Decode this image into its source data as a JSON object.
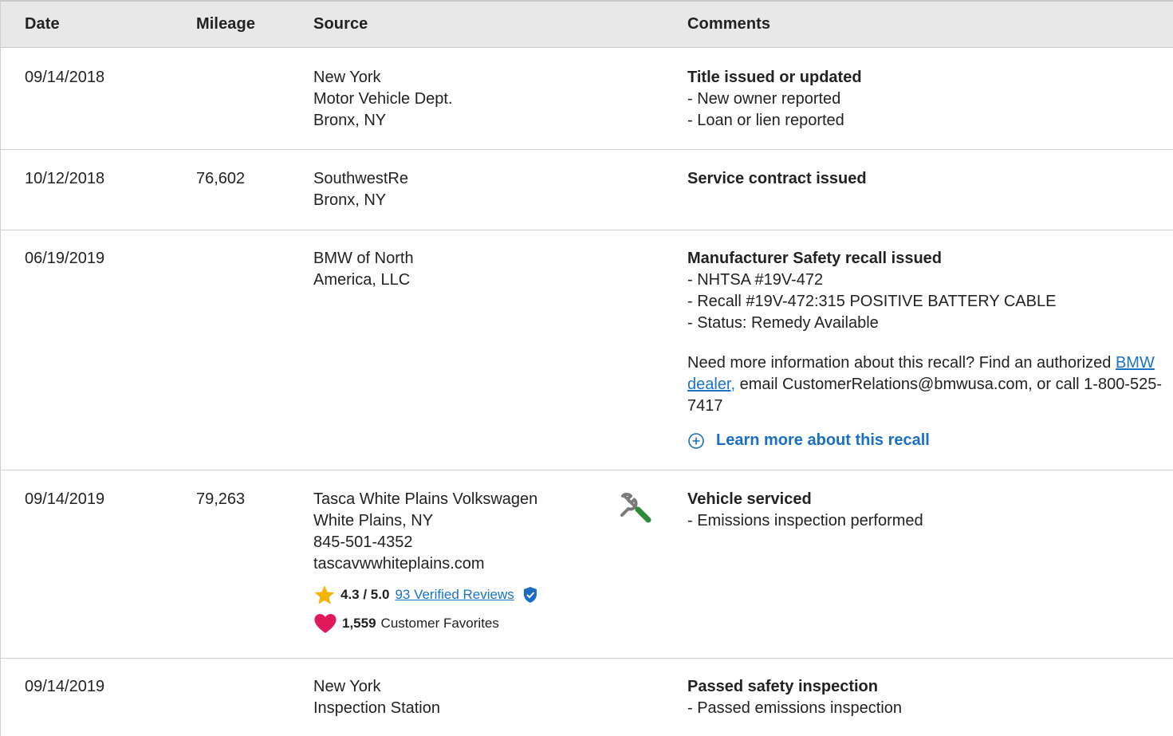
{
  "header": {
    "date": "Date",
    "mileage": "Mileage",
    "source": "Source",
    "comments": "Comments"
  },
  "rows": [
    {
      "date": "09/14/2018",
      "mileage": "",
      "source": [
        "New York",
        "Motor Vehicle Dept.",
        "Bronx, NY"
      ],
      "title": "Title issued or updated",
      "items": [
        "New owner reported",
        "Loan or lien reported"
      ]
    },
    {
      "date": "10/12/2018",
      "mileage": "76,602",
      "source": [
        "SouthwestRe",
        "Bronx, NY"
      ],
      "title": "Service contract issued",
      "items": []
    },
    {
      "date": "06/19/2019",
      "mileage": "",
      "source": [
        "BMW of North",
        "America, LLC"
      ],
      "title": "Manufacturer Safety recall issued",
      "items": [
        "NHTSA #19V-472",
        "Recall #19V-472:315 POSITIVE BATTERY CABLE",
        "Status: Remedy Available"
      ],
      "info_pre": "Need more information about this recall? Find an authorized ",
      "info_link": "BMW dealer,",
      "info_post": " email CustomerRelations@bmwusa.com, or call 1-800-525-7417",
      "learn_more": "Learn more about this recall"
    },
    {
      "date": "09/14/2019",
      "mileage": "79,263",
      "source": [
        "Tasca White Plains Volkswagen",
        "White Plains, NY",
        "845-501-4352",
        "tascavwwhiteplains.com"
      ],
      "rating": "4.3 / 5.0",
      "reviews": "93 Verified Reviews",
      "favorites_count": "1,559",
      "favorites_label": "Customer Favorites",
      "title": "Vehicle serviced",
      "items": [
        "Emissions inspection performed"
      ]
    },
    {
      "date": "09/14/2019",
      "mileage": "",
      "source": [
        "New York",
        "Inspection Station"
      ],
      "title": "Passed safety inspection",
      "items": [
        "Passed emissions inspection"
      ]
    }
  ],
  "colors": {
    "link": "#1a73c8",
    "header_bg": "#e8e8e8",
    "star": "#f5b400",
    "heart": "#e0195a",
    "badge": "#1a6fc4"
  },
  "icons": [
    "tools-icon",
    "star-icon",
    "verified-badge-icon",
    "heart-icon",
    "plus-circle-icon"
  ]
}
